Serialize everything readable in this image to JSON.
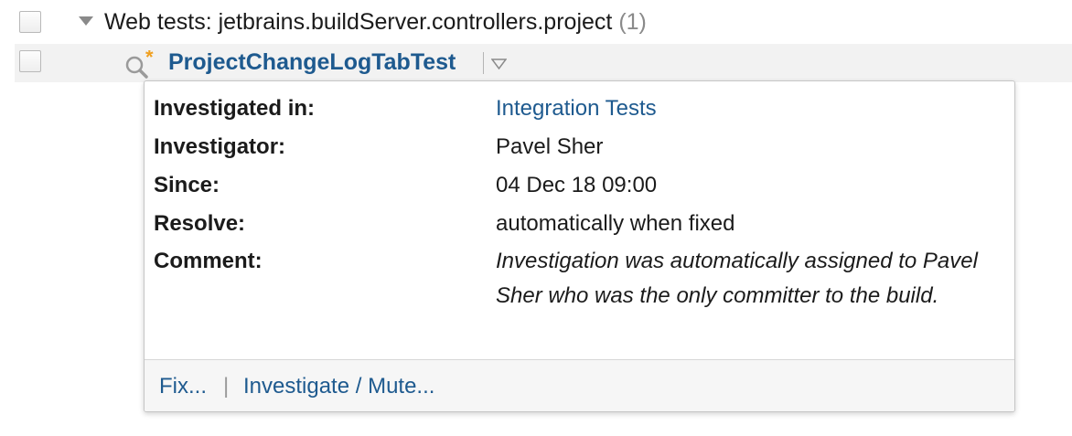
{
  "group": {
    "title": "Web tests: jetbrains.buildServer.controllers.project",
    "count": "(1)"
  },
  "test": {
    "name": "ProjectChangeLogTabTest",
    "icon": "investigation-magnifier-icon"
  },
  "investigation": {
    "investigated_in_label": "Investigated in:",
    "investigated_in_value": "Integration Tests",
    "investigator_label": "Investigator:",
    "investigator_value": "Pavel Sher",
    "since_label": "Since:",
    "since_value": "04 Dec 18 09:00",
    "resolve_label": "Resolve:",
    "resolve_value": "automatically when fixed",
    "comment_label": "Comment:",
    "comment_value": "Investigation was automatically assigned to Pavel Sher who was the only committer to the build."
  },
  "actions": {
    "fix": "Fix...",
    "separator": "|",
    "investigate_mute": "Investigate / Mute..."
  },
  "colors": {
    "link": "#1e5a8f",
    "investigation_star": "#f0a020"
  }
}
